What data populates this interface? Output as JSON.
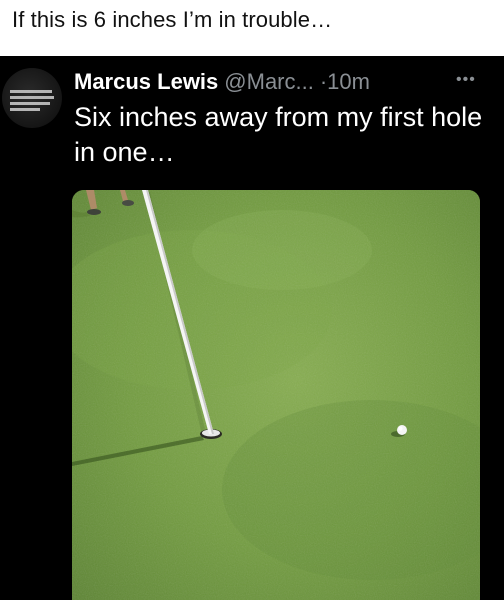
{
  "caption": "If this is 6 inches I’m in trouble…",
  "tweet": {
    "author_name": "Marcus Lewis",
    "handle": "@Marc...",
    "time": "·10m",
    "more_icon": "more-horizontal-icon",
    "text": "Six inches away from my first hole in one…"
  },
  "colors": {
    "tweet_background": "#000000",
    "muted_text": "#8a8f94",
    "green": "#6f9a3e"
  }
}
